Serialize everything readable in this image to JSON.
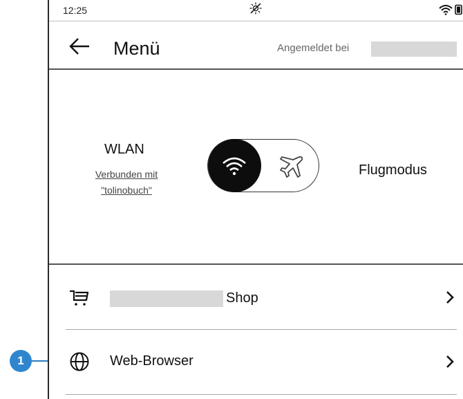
{
  "status_bar": {
    "time": "12:25",
    "icons": [
      "sun-off-icon",
      "wifi-icon",
      "battery-icon"
    ]
  },
  "header": {
    "title": "Menü",
    "back_icon": "arrow-left-icon",
    "signed_in_label": "Angemeldet bei"
  },
  "connectivity": {
    "wlan_title": "WLAN",
    "wlan_status_line1": "Verbunden mit",
    "wlan_status_line2": "\"tolinobuch\"",
    "airplane_label": "Flugmodus",
    "toggle_selected": "WLAN"
  },
  "menu_items": [
    {
      "label": "Shop",
      "icon": "cart-icon"
    },
    {
      "label": "Web-Browser",
      "icon": "globe-icon"
    }
  ],
  "callout": {
    "number": "1"
  },
  "colors": {
    "callout": "#2f86cf",
    "toggle_knob": "#0d0d0d"
  }
}
